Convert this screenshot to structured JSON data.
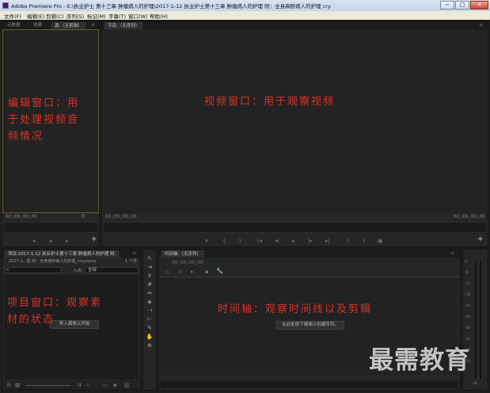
{
  "window": {
    "title": "Adobe Premiere Pro - E:\\执业护士 第十三章 肿瘤病人的护理\\2017-1-12  执业护士第十三章 肿瘤病人的护理 附：全身麻醉病人的护理  cry",
    "min": "−",
    "max": "□",
    "close": "✕"
  },
  "menu": [
    "文件(F)",
    "编辑(E)",
    "剪辑(C)",
    "序列(S)",
    "标记(M)",
    "字幕(T)",
    "窗口(W)",
    "帮助(H)"
  ],
  "source_panel": {
    "tabs": [
      "元数据",
      "效果",
      "源:（无剪辑）"
    ],
    "timecode": "00;00;00;00",
    "annotation": [
      "编辑窗口：用",
      "于处理视频音",
      "频情况"
    ]
  },
  "program_panel": {
    "tab": "节目:（无序列）",
    "timecode_left": "00;00;00;00",
    "timecode_right": "00;00;00;00",
    "annotation": "视频窗口：用于观察视频"
  },
  "project_panel": {
    "tab": "项目:2017-1-12 执业护士第十三章 肿瘤病人的护理 附:",
    "file_label": "2017-1...理 附：全身麻醉病人的护理_cry.prproj",
    "item_count": "1 个项",
    "search_icon": "search-icon",
    "in_label": "入点:",
    "in_value": "全部",
    "annotation": [
      "项目窗口：观察素",
      "材的状态"
    ],
    "import_hint": "导入媒体以开始"
  },
  "timeline_panel": {
    "tab": "时间轴:（无序列）",
    "timecode": "00;00;00;00",
    "annotation": "时间轴：观察时间线以及剪辑",
    "drop_hint": "在此处放下媒体以创建序列。"
  },
  "audio_meter": {
    "ticks": [
      "0",
      "-6",
      "-12",
      "-18",
      "-24",
      "-30",
      "-36",
      "-42",
      "-48",
      "-54"
    ],
    "bottom": "dB"
  },
  "tools": [
    "selection-tool-icon",
    "track-select-icon",
    "ripple-edit-icon",
    "rolling-edit-icon",
    "rate-stretch-icon",
    "razor-icon",
    "slip-icon",
    "slide-icon",
    "pen-icon",
    "hand-icon",
    "zoom-icon"
  ],
  "watermark": "最需教育"
}
